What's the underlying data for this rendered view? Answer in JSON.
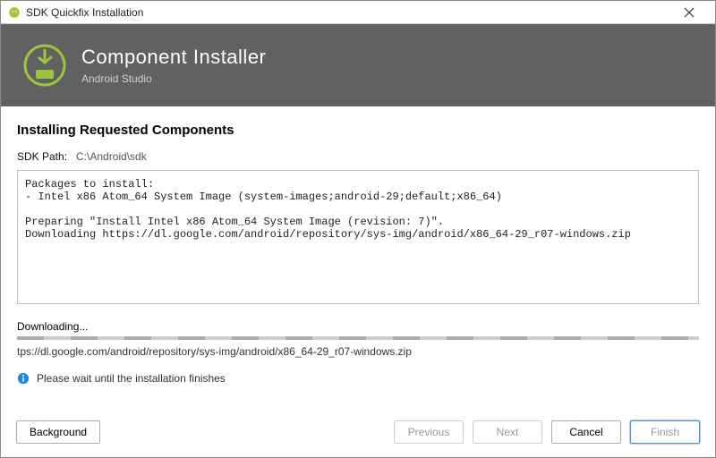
{
  "window": {
    "title": "SDK Quickfix Installation"
  },
  "banner": {
    "heading": "Component Installer",
    "sub": "Android Studio"
  },
  "section_title": "Installing Requested Components",
  "sdk_path_label": "SDK Path:",
  "sdk_path_value": "C:\\Android\\sdk",
  "log": "Packages to install:\n- Intel x86 Atom_64 System Image (system-images;android-29;default;x86_64)\n\nPreparing \"Install Intel x86 Atom_64 System Image (revision: 7)\".\nDownloading https://dl.google.com/android/repository/sys-img/android/x86_64-29_r07-windows.zip",
  "status_text": "Downloading...",
  "detail_text": "tps://dl.google.com/android/repository/sys-img/android/x86_64-29_r07-windows.zip",
  "wait_message": "Please wait until the installation finishes",
  "buttons": {
    "background": "Background",
    "previous": "Previous",
    "next": "Next",
    "cancel": "Cancel",
    "finish": "Finish"
  }
}
